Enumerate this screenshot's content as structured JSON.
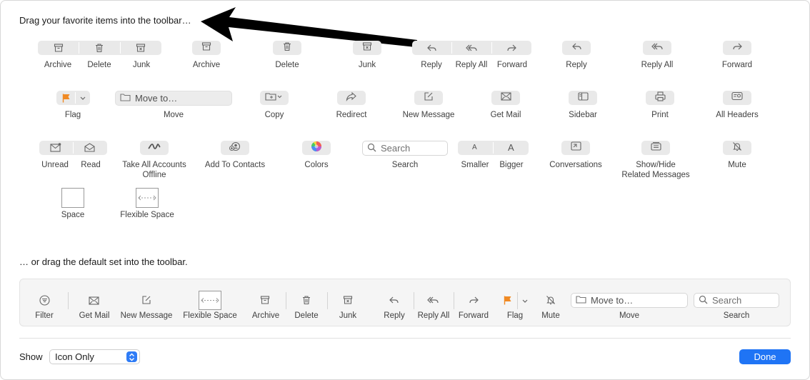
{
  "headings": {
    "favorites": "Drag your favorite items into the toolbar…",
    "default_set": "… or drag the default set into the toolbar."
  },
  "items": {
    "archive_group": "Archive",
    "delete_group": "Delete",
    "junk_group": "Junk",
    "archive": "Archive",
    "delete": "Delete",
    "junk": "Junk",
    "reply_group": "Reply",
    "reply_all_group": "Reply All",
    "forward_group": "Forward",
    "reply": "Reply",
    "reply_all": "Reply All",
    "forward": "Forward",
    "flag": "Flag",
    "move": "Move",
    "move_placeholder": "Move to…",
    "copy": "Copy",
    "redirect": "Redirect",
    "new_message": "New Message",
    "get_mail": "Get Mail",
    "sidebar": "Sidebar",
    "print": "Print",
    "all_headers": "All Headers",
    "unread": "Unread",
    "read": "Read",
    "take_offline_line1": "Take All Accounts",
    "take_offline_line2": "Offline",
    "add_to_contacts": "Add To Contacts",
    "colors": "Colors",
    "search": "Search",
    "search_placeholder": "Search",
    "smaller": "Smaller",
    "bigger": "Bigger",
    "smaller_glyph": "A",
    "bigger_glyph": "A",
    "conversations": "Conversations",
    "show_hide_line1": "Show/Hide",
    "show_hide_line2": "Related Messages",
    "mute": "Mute",
    "space": "Space",
    "flexible_space": "Flexible Space"
  },
  "default_set": {
    "filter": "Filter",
    "get_mail": "Get Mail",
    "new_message": "New Message",
    "flexible_space": "Flexible Space",
    "archive": "Archive",
    "delete": "Delete",
    "junk": "Junk",
    "reply": "Reply",
    "reply_all": "Reply All",
    "forward": "Forward",
    "flag": "Flag",
    "mute": "Mute",
    "move": "Move",
    "move_placeholder": "Move to…",
    "search": "Search",
    "search_placeholder": "Search"
  },
  "footer": {
    "show_label": "Show",
    "show_value": "Icon Only",
    "done": "Done"
  },
  "colors": {
    "accent": "#1f74f5",
    "flag": "#f08a24"
  }
}
